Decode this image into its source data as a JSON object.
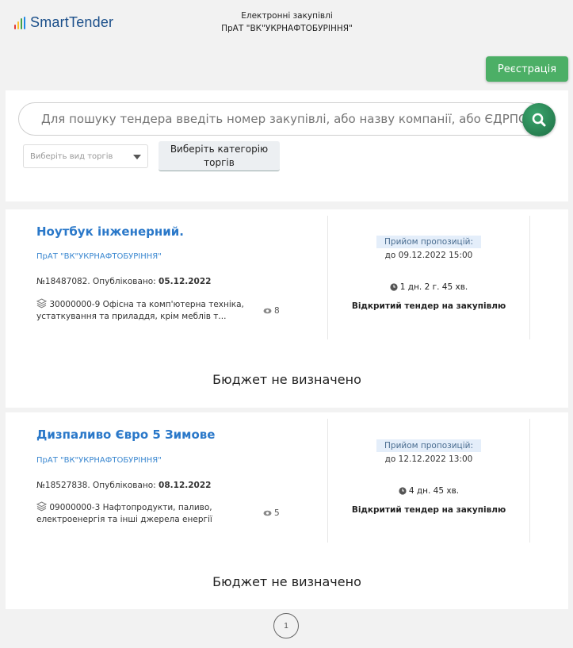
{
  "header": {
    "logo_text": "SmartTender",
    "center_line1": "Електронні закупівлі",
    "center_line2": "ПрАТ \"ВК\"УКРНАФТОБУРІННЯ\""
  },
  "register_button": "Реєстрація",
  "search": {
    "placeholder": "Для пошуку тендера введіть номер закупівлі, або назву компанії, або ЄДРПОУ",
    "type_select": "Виберіть вид торгів",
    "category_button": "Виберіть категорію торгів"
  },
  "tenders": [
    {
      "title": "Ноутбук інженерний.",
      "company": "ПрАТ \"ВК\"УКРНАФТОБУРІННЯ\"",
      "number": "№18487082. Опубліковано: ",
      "published": "05.12.2022",
      "classification": "30000000-9 Офісна та комп'ютерна техніка, устаткування та приладдя, крім меблів т...",
      "views": "8",
      "badge": "Прийом пропозицій:",
      "deadline": "до 09.12.2022 15:00",
      "timer": "1 дн. 2 г. 45 хв.",
      "procedure": "Відкритий тендер на закупівлю",
      "budget": "Бюджет не визначено"
    },
    {
      "title": "Дизпаливо Євро 5 Зимове",
      "company": "ПрАТ \"ВК\"УКРНАФТОБУРІННЯ\"",
      "number": "№18527838. Опубліковано: ",
      "published": "08.12.2022",
      "classification": "09000000-3 Нафтопродукти, паливо, електроенергія та інші джерела енергії",
      "views": "5",
      "badge": "Прийом пропозицій:",
      "deadline": "до 12.12.2022 13:00",
      "timer": "4 дн. 45 хв.",
      "procedure": "Відкритий тендер на закупівлю",
      "budget": "Бюджет не визначено"
    }
  ],
  "pagination": {
    "current": "1"
  },
  "colors": {
    "accent": "#2a78c9",
    "register": "#4caf66",
    "search_button": "#2e8b57",
    "badge_bg": "#e4eefa"
  }
}
